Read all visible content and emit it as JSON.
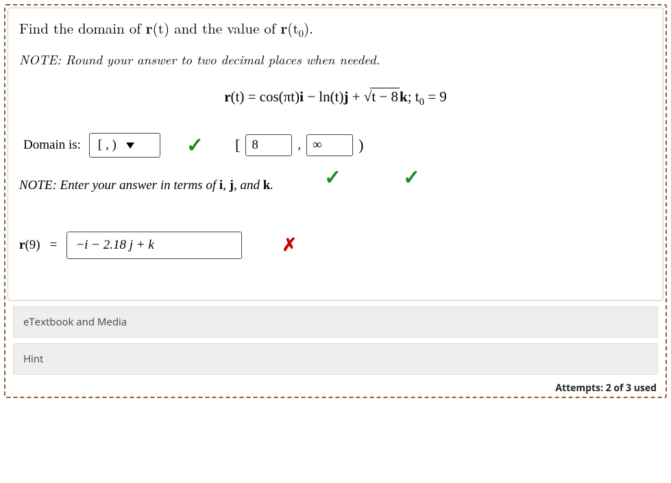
{
  "prompt": {
    "pre": "Find the domain of ",
    "rt": "r",
    "paren_t": "(t)",
    "mid": " and the value of ",
    "rt0_r": "r",
    "rt0_open": "(t",
    "rt0_sub": "0",
    "rt0_close": ")."
  },
  "note1": "NOTE:  Round your answer to two decimal places when needed.",
  "equation": {
    "lhs_r": "r",
    "lhs_t": "(t) = cos(πt)",
    "i": "i",
    "minus_ln": " − ln(t)",
    "j": "j",
    "plus": " + ",
    "sqrt_sym": "√",
    "sqrt_inner": "t − 8",
    "k": "k",
    "tail": "; t",
    "sub0": "0",
    "tail2": " = 9"
  },
  "domain": {
    "label": "Domain is:",
    "select_value": "[  ,   )",
    "bracket_open": "[",
    "lower_value": "8",
    "comma": ",",
    "upper_value": "∞",
    "bracket_close": ")"
  },
  "note2": {
    "pre": "NOTE:  Enter your answer in terms of ",
    "i": "i",
    "c1": ", ",
    "j": "j",
    "c2": ", and ",
    "k": "k",
    "dot": "."
  },
  "answer": {
    "lhs_r": "r",
    "lhs_nine": "(9)",
    "equals": "=",
    "value": "−i − 2.18 j + k"
  },
  "accordions": {
    "etext": "eTextbook and Media",
    "hint": "Hint"
  },
  "attempts": "Attempts: 2 of 3 used"
}
